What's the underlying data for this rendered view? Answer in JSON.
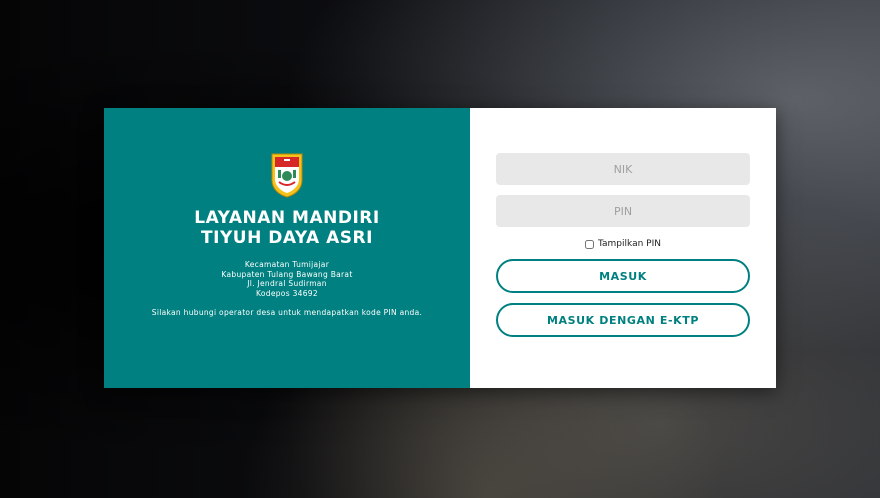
{
  "brand": {
    "title_line1": "LAYANAN MANDIRI",
    "title_line2": "TIYUH DAYA ASRI",
    "address": [
      "Kecamatan Tumijajar",
      "Kabupaten Tulang Bawang Barat",
      "Jl. Jendral Sudirman",
      "Kodepos 34692"
    ],
    "note": "Silakan hubungi operator desa untuk mendapatkan kode PIN anda.",
    "accent_color": "#008080",
    "logo_icon": "regency-crest-icon"
  },
  "form": {
    "nik_placeholder": "NIK",
    "pin_placeholder": "PIN",
    "show_pin_label": "Tampilkan PIN",
    "login_button": "MASUK",
    "ektp_button": "MASUK DENGAN E-KTP"
  }
}
